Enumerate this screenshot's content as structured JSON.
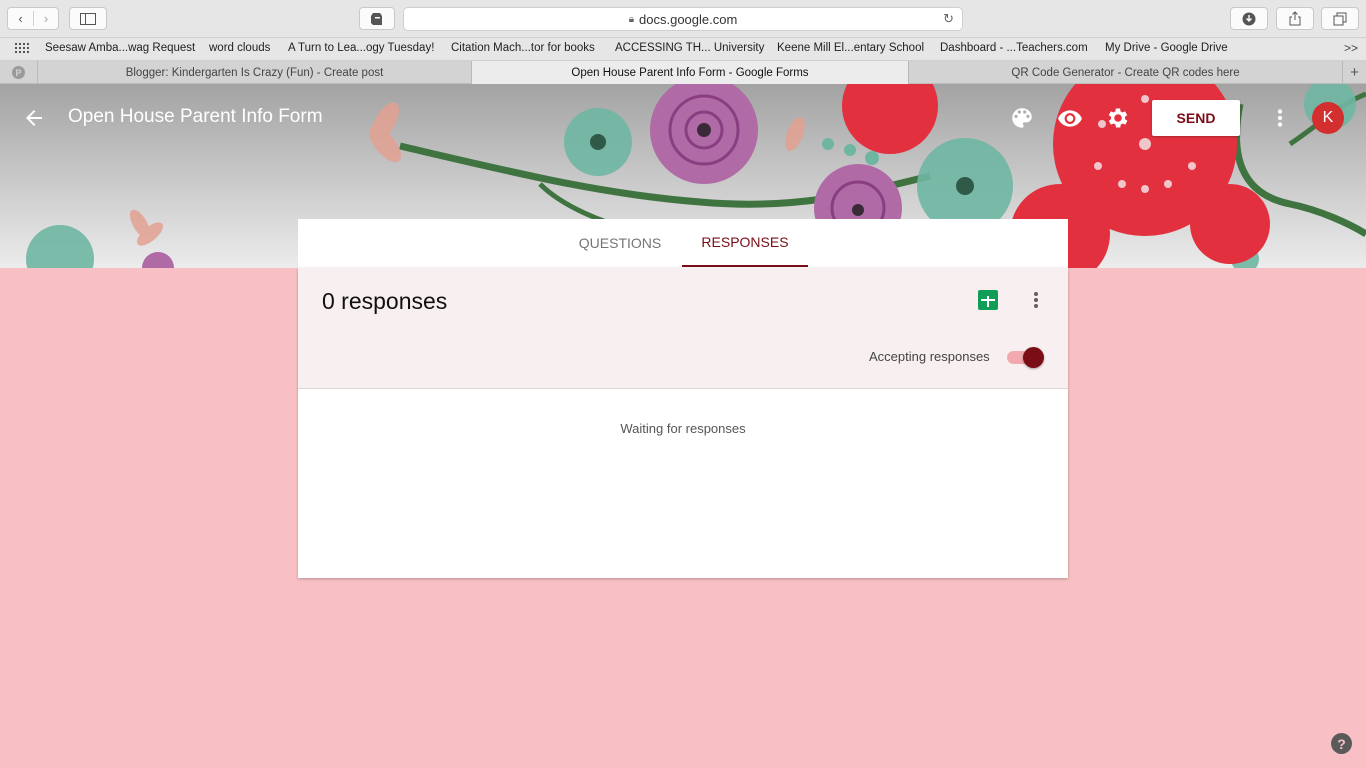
{
  "browser": {
    "url": "docs.google.com",
    "bookmarks": [
      "Seesaw Amba...wag Request",
      "word clouds",
      "A Turn to Lea...ogy Tuesday!",
      "Citation Mach...tor for books",
      "ACCESSING TH... University",
      "Keene Mill El...entary School",
      "Dashboard - ...Teachers.com",
      "My Drive - Google Drive"
    ],
    "bookmarks_more": ">>",
    "tabs": [
      "Blogger: Kindergarten Is Crazy (Fun) - Create post",
      "Open House Parent Info Form - Google Forms",
      "QR Code Generator - Create QR codes here"
    ],
    "pinned_tab_glyph": "P",
    "new_tab_glyph": "+"
  },
  "form": {
    "title": "Open House Parent Info Form",
    "send_label": "SEND",
    "avatar_initial": "K",
    "tabs": {
      "questions": "QUESTIONS",
      "responses": "RESPONSES"
    },
    "responses": {
      "count_text": "0 responses",
      "accepting_label": "Accepting responses",
      "accepting": true,
      "waiting_text": "Waiting for responses"
    },
    "help_glyph": "?"
  },
  "colors": {
    "page_background": "#f8c0c4",
    "accent": "#7b0d17",
    "sheets_green": "#0f9d58",
    "avatar_red": "#d32f2f"
  }
}
